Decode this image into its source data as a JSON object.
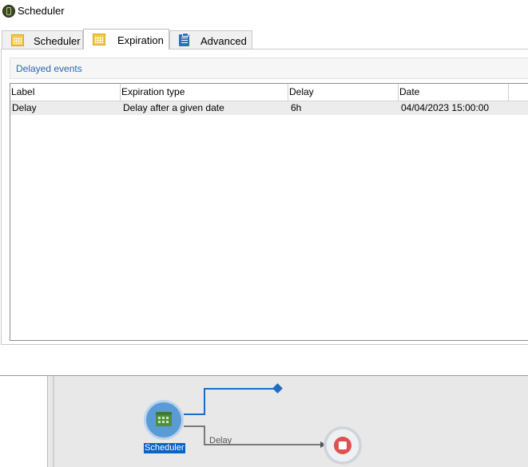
{
  "window": {
    "title": "Scheduler"
  },
  "tabs": [
    {
      "label": "Scheduler",
      "icon": "calendar-icon",
      "active": false
    },
    {
      "label": "Expiration",
      "icon": "calendar-icon",
      "active": true
    },
    {
      "label": "Advanced",
      "icon": "clipboard-icon",
      "active": false
    }
  ],
  "section": {
    "title": "Delayed events"
  },
  "table": {
    "columns": [
      "Label",
      "Expiration type",
      "Delay",
      "Date"
    ],
    "rows": [
      {
        "label": "Delay",
        "expiration_type": "Delay after a given date",
        "delay": "6h",
        "date": "04/04/2023 15:00:00"
      }
    ]
  },
  "workflow": {
    "node_label": "Scheduler",
    "link_label": "Delay",
    "colors": {
      "active_link": "#1a6fc4",
      "delay_link": "#555555",
      "node": "#5b9bd5",
      "end_node": "#e05050"
    }
  }
}
